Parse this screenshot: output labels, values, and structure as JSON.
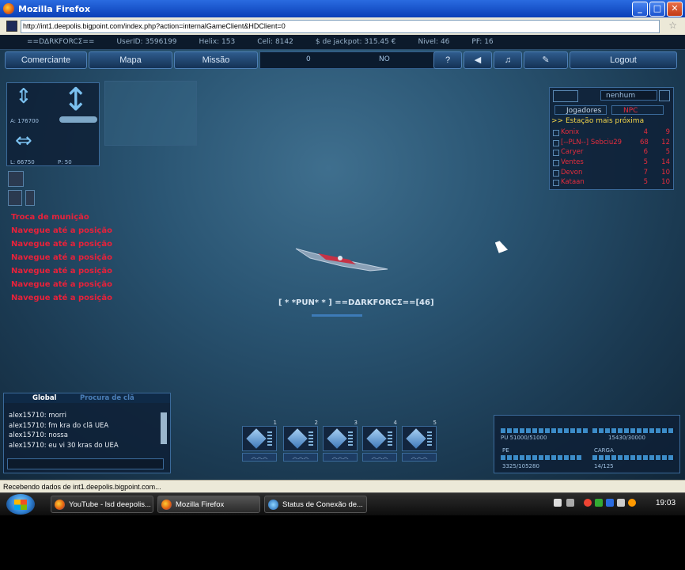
{
  "window": {
    "title": "Mozilla Firefox"
  },
  "url": "http://int1.deepolis.bigpoint.com/index.php?action=internalGameClient&HDClient=0",
  "stats_bar": {
    "username": "==DΔRKFORCΣ==",
    "userid": "UserID: 3596199",
    "helix": "Helix: 153",
    "celi": "Celi: 8142",
    "jackpot": "$ de jackpot: 315.45 €",
    "nivel": "Nivel: 46",
    "pf": "PF: 16"
  },
  "menu": {
    "comerciante": "Comerciante",
    "mapa": "Mapa",
    "missao": "Missão",
    "center_value": "0",
    "center_label": "NO",
    "help": "?",
    "logout": "Logout"
  },
  "nav": {
    "a_value": "A: 176700",
    "l_value": "L: 66750",
    "p_value": "P: 50"
  },
  "messages": [
    "Troca de munição",
    "Navegue até a posição",
    "Navegue até a posição",
    "Navegue até a posição",
    "Navegue até a posição",
    "Navegue até a posição",
    "Navegue até a posição"
  ],
  "player_label": "[ * *PUN* * ] ==DΔRKFORCΣ==[46]",
  "right_panel": {
    "dropdown": "nenhum",
    "tab_players": "Jogadores",
    "tab_npc": "NPC",
    "station": ">> Estação mais próxima",
    "players": [
      {
        "name": "Konix",
        "a": "4",
        "b": "9"
      },
      {
        "name": "[--PLN--] Sebciu29",
        "a": "68",
        "b": "12"
      },
      {
        "name": "Caryer",
        "a": "6",
        "b": "5"
      },
      {
        "name": "Ventes",
        "a": "5",
        "b": "14"
      },
      {
        "name": "Devon",
        "a": "7",
        "b": "10"
      },
      {
        "name": "Kataan",
        "a": "5",
        "b": "10"
      }
    ]
  },
  "chat": {
    "tab_global": "Global",
    "tab_clan": "Procura de clã",
    "lines": [
      "alex15710: morri",
      "alex15710: fm kra do clã UEA",
      "alex15710: nossa",
      "alex15710: eu vi 30 kras do UEA"
    ]
  },
  "slots": [
    "1",
    "2",
    "3",
    "4",
    "5"
  ],
  "ship_stats": {
    "pu_label": "PU 51000/51000",
    "hp_label": "15430/30000",
    "pe_label": "PE",
    "pe_value": "3325/105280",
    "carga_label": "CARGA",
    "carga_value": "14/125"
  },
  "status": "Recebendo dados de int1.deepolis.bigpoint.com...",
  "taskbar": {
    "items": [
      "YouTube - lsd deepolis...",
      "Mozilla Firefox",
      "Status de Conexão de..."
    ],
    "clock": "19:03"
  }
}
